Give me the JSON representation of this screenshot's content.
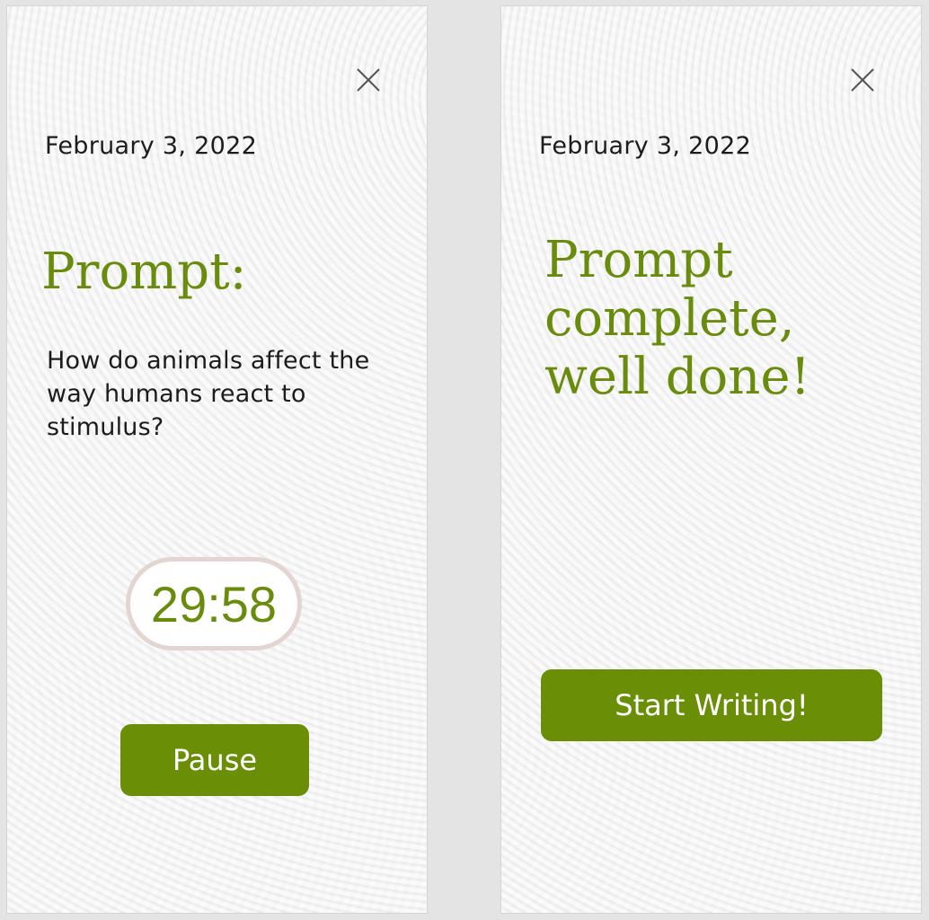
{
  "left_screen": {
    "date": "February 3, 2022",
    "heading": "Prompt:",
    "prompt_text": "How do animals affect the way humans react to stimulus?",
    "timer": "29:58",
    "pause_label": "Pause"
  },
  "right_screen": {
    "date": "February 3, 2022",
    "heading": "Prompt complete, well done!",
    "start_label": "Start Writing!"
  },
  "colors": {
    "accent_green": "#6b8e07",
    "heading_green": "#6a8c0d",
    "timer_border": "#e3d5d1",
    "background": "#f3f3f3"
  },
  "icons": {
    "close": "close-icon"
  }
}
